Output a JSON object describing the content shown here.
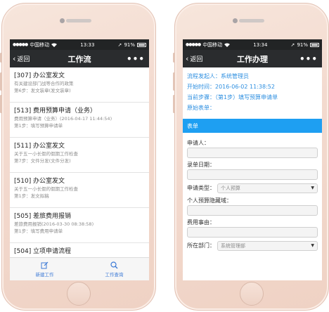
{
  "left": {
    "status": {
      "carrier": "中国移动",
      "time": "13:33",
      "battery": "91%"
    },
    "nav": {
      "back_label": "返回",
      "title": "工作流",
      "more": "•••"
    },
    "items": [
      {
        "title": "[307] 办公室发文",
        "sub1": "有关建设部门战等合作的政策",
        "sub2": "第6步：发文装章(发文装章)"
      },
      {
        "title": "[513] 费用预算申请（业务）",
        "sub1": "费用预算申请（业务）(2016-04-17 11:44:54)",
        "sub2": "第1步：填写预算申请单"
      },
      {
        "title": "[511] 办公室发文",
        "sub1": "关于五一小长假的假期工作检查",
        "sub2": "第7步：文件分发(文件分发)"
      },
      {
        "title": "[510] 办公室发文",
        "sub1": "关于五一小长假的假期工作检查",
        "sub2": "第1步：发文拟稿"
      },
      {
        "title": "[505] 差旅费用报销",
        "sub1": "差旅费用报销(2016-03-30 08:38:58)",
        "sub2": "第1步：填写费用申请单"
      },
      {
        "title": "[504] 立项申请流程",
        "sub1": "",
        "sub2": ""
      }
    ],
    "tabs": [
      {
        "label": "新建工作",
        "icon": "edit-icon"
      },
      {
        "label": "工作查询",
        "icon": "search-icon"
      }
    ]
  },
  "right": {
    "status": {
      "carrier": "中国移动",
      "time": "13:34",
      "battery": "91%"
    },
    "nav": {
      "back_label": "返回",
      "title": "工作办理",
      "more": "•••"
    },
    "info": [
      "流程发起人：系统管理员",
      "开始时间：2016-06-02  11:38:52",
      "当前步骤：（第1步）填写预算申请单",
      "原始表单："
    ],
    "section": "表单",
    "form": {
      "applicant_label": "申请人：",
      "date_label": "录单日期：",
      "type_label": "申请类型：",
      "type_value": "个人预算",
      "hidden_label": "个人预算隐藏域：",
      "reason_label": "费用事由：",
      "dept_label": "所在部门：",
      "dept_value": "系统管理部"
    }
  },
  "colors": {
    "accent_blue": "#1e9ff2",
    "info_text": "#2e8fe0",
    "navbar": "#2a2c2e",
    "tab_text": "#3d7bd6"
  }
}
